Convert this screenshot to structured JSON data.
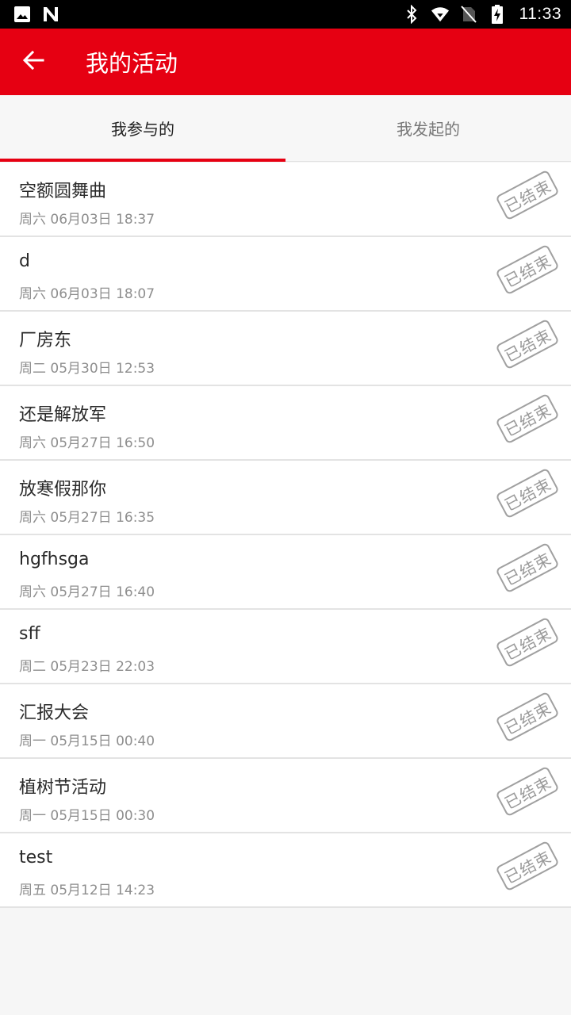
{
  "status_bar": {
    "time": "11:33",
    "icons": [
      "image-icon",
      "n-icon",
      "bluetooth-icon",
      "wifi-icon",
      "no-sim-icon",
      "battery-charging-icon"
    ]
  },
  "app_bar": {
    "back_icon": "arrow-left-icon",
    "title": "我的活动"
  },
  "tabs": [
    {
      "label": "我参与的",
      "active": true
    },
    {
      "label": "我发起的",
      "active": false
    }
  ],
  "colors": {
    "accent": "#e60012"
  },
  "activities": [
    {
      "title": "空额圆舞曲",
      "time": "周六 06月03日 18:37",
      "status": "已结束"
    },
    {
      "title": "d",
      "time": "周六 06月03日 18:07",
      "status": "已结束"
    },
    {
      "title": "厂房东",
      "time": "周二 05月30日 12:53",
      "status": "已结束"
    },
    {
      "title": "还是解放军",
      "time": "周六 05月27日 16:50",
      "status": "已结束"
    },
    {
      "title": "放寒假那你",
      "time": "周六 05月27日 16:35",
      "status": "已结束"
    },
    {
      "title": "hgfhsga",
      "time": "周六 05月27日 16:40",
      "status": "已结束"
    },
    {
      "title": "sff",
      "time": "周二 05月23日 22:03",
      "status": "已结束"
    },
    {
      "title": "汇报大会",
      "time": "周一 05月15日 00:40",
      "status": "已结束"
    },
    {
      "title": "植树节活动",
      "time": "周一 05月15日 00:30",
      "status": "已结束"
    },
    {
      "title": "test",
      "time": "周五 05月12日 14:23",
      "status": "已结束"
    }
  ]
}
